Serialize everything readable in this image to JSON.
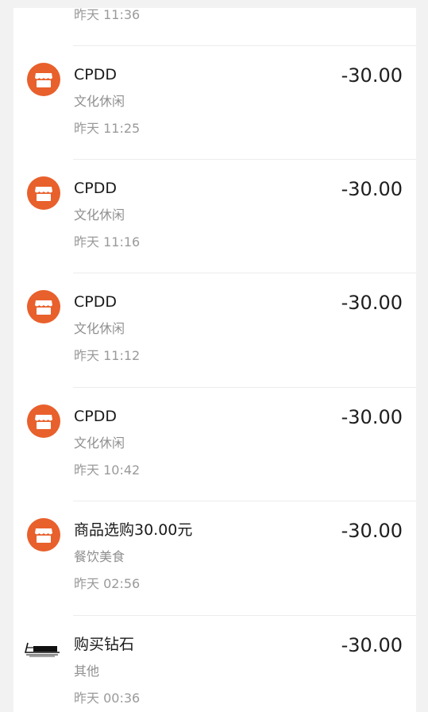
{
  "partial_top": {
    "time": "昨天 11:36"
  },
  "transactions": [
    {
      "title": "CPDD",
      "category": "文化休闲",
      "time": "昨天 11:25",
      "amount": "-30.00",
      "icon": "store-icon"
    },
    {
      "title": "CPDD",
      "category": "文化休闲",
      "time": "昨天 11:16",
      "amount": "-30.00",
      "icon": "store-icon"
    },
    {
      "title": "CPDD",
      "category": "文化休闲",
      "time": "昨天 11:12",
      "amount": "-30.00",
      "icon": "store-icon"
    },
    {
      "title": "CPDD",
      "category": "文化休闲",
      "time": "昨天 10:42",
      "amount": "-30.00",
      "icon": "store-icon"
    },
    {
      "title": "商品选购30.00元",
      "category": "餐饮美食",
      "time": "昨天 02:56",
      "amount": "-30.00",
      "icon": "store-icon"
    },
    {
      "title": "购买钻石",
      "category": "其他",
      "time": "昨天 00:36",
      "amount": "-30.00",
      "icon": "merchant-logo-icon"
    }
  ],
  "colors": {
    "accent": "#e8602c",
    "background": "#f2f2f2",
    "card": "#ffffff"
  }
}
